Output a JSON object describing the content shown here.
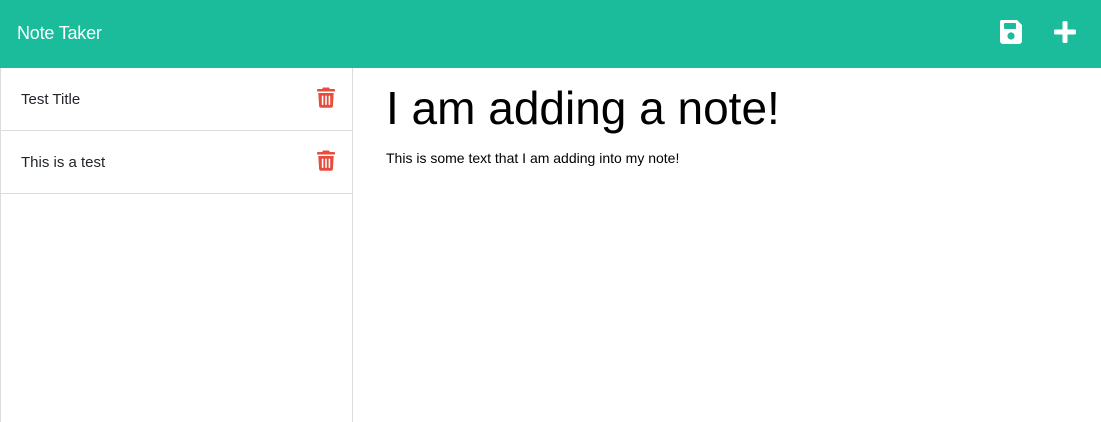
{
  "app": {
    "title": "Note Taker",
    "accent_color": "#1abc9c"
  },
  "toolbar": {
    "save_icon": "floppy-disk-icon",
    "new_icon": "plus-icon"
  },
  "sidebar": {
    "notes": [
      {
        "title": "Test Title",
        "delete_icon": "trash-icon"
      },
      {
        "title": "This is a test",
        "delete_icon": "trash-icon"
      }
    ],
    "delete_color": "#e74c3c"
  },
  "editor": {
    "title_value": "I am adding a note!",
    "text_value": "This is some text that I am adding into my note!"
  }
}
